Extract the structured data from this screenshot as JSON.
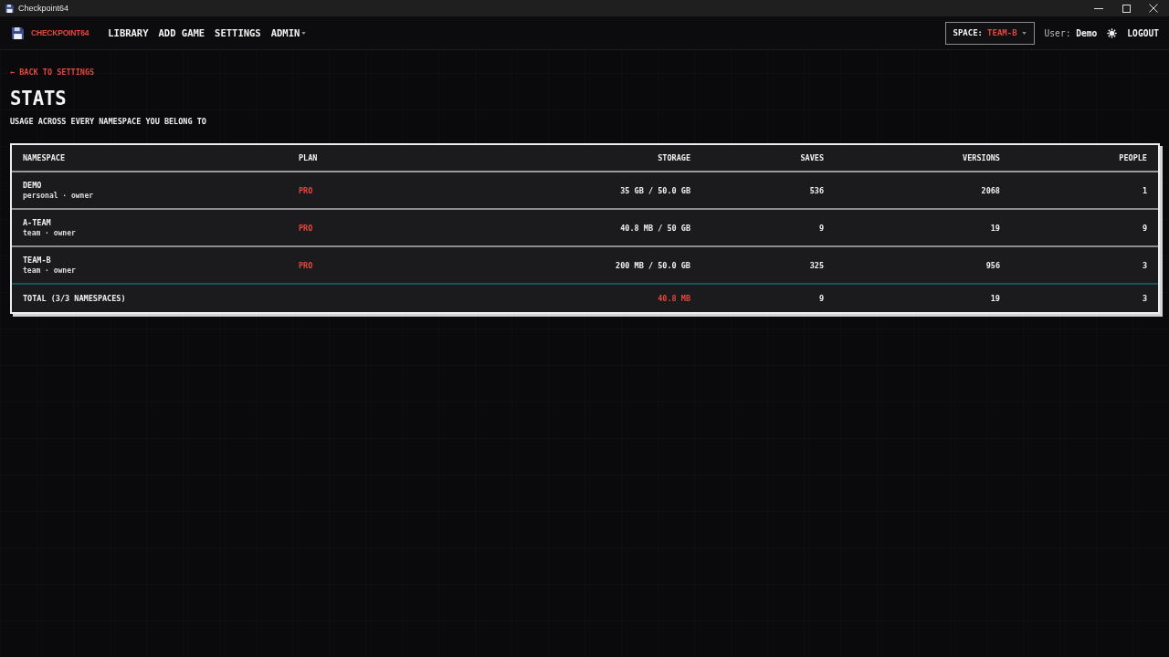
{
  "window": {
    "title": "Checkpoint64"
  },
  "nav": {
    "brand": "CHECKPOINT64",
    "links": [
      {
        "label": "LIBRARY",
        "dropdown": false
      },
      {
        "label": "ADD GAME",
        "dropdown": false
      },
      {
        "label": "SETTINGS",
        "dropdown": false
      },
      {
        "label": "ADMIN",
        "dropdown": true
      }
    ],
    "space": {
      "label": "SPACE:",
      "value": "TEAM-B"
    },
    "user": {
      "label": "User:",
      "name": "Demo"
    },
    "logout": "LOGOUT"
  },
  "back_link": "← BACK TO SETTINGS",
  "page": {
    "title": "STATS",
    "subtitle": "USAGE ACROSS EVERY NAMESPACE YOU BELONG TO"
  },
  "table": {
    "columns": [
      "NAMESPACE",
      "PLAN",
      "STORAGE",
      "SAVES",
      "VERSIONS",
      "PEOPLE"
    ],
    "rows": [
      {
        "namespace": "DEMO",
        "role": "personal · owner",
        "plan": "PRO",
        "storage": "35 GB / 50.0 GB",
        "saves": "536",
        "versions": "2068",
        "people": "1"
      },
      {
        "namespace": "A-TEAM",
        "role": "team · owner",
        "plan": "PRO",
        "storage": "40.8 MB / 50 GB",
        "saves": "9",
        "versions": "19",
        "people": "9"
      },
      {
        "namespace": "TEAM-B",
        "role": "team · owner",
        "plan": "PRO",
        "storage": "200 MB / 50.0 GB",
        "saves": "325",
        "versions": "956",
        "people": "3"
      }
    ],
    "total": {
      "label": "TOTAL (3/3 NAMESPACES)",
      "storage": "40.8 MB",
      "saves": "9",
      "versions": "19",
      "people": "3"
    }
  }
}
